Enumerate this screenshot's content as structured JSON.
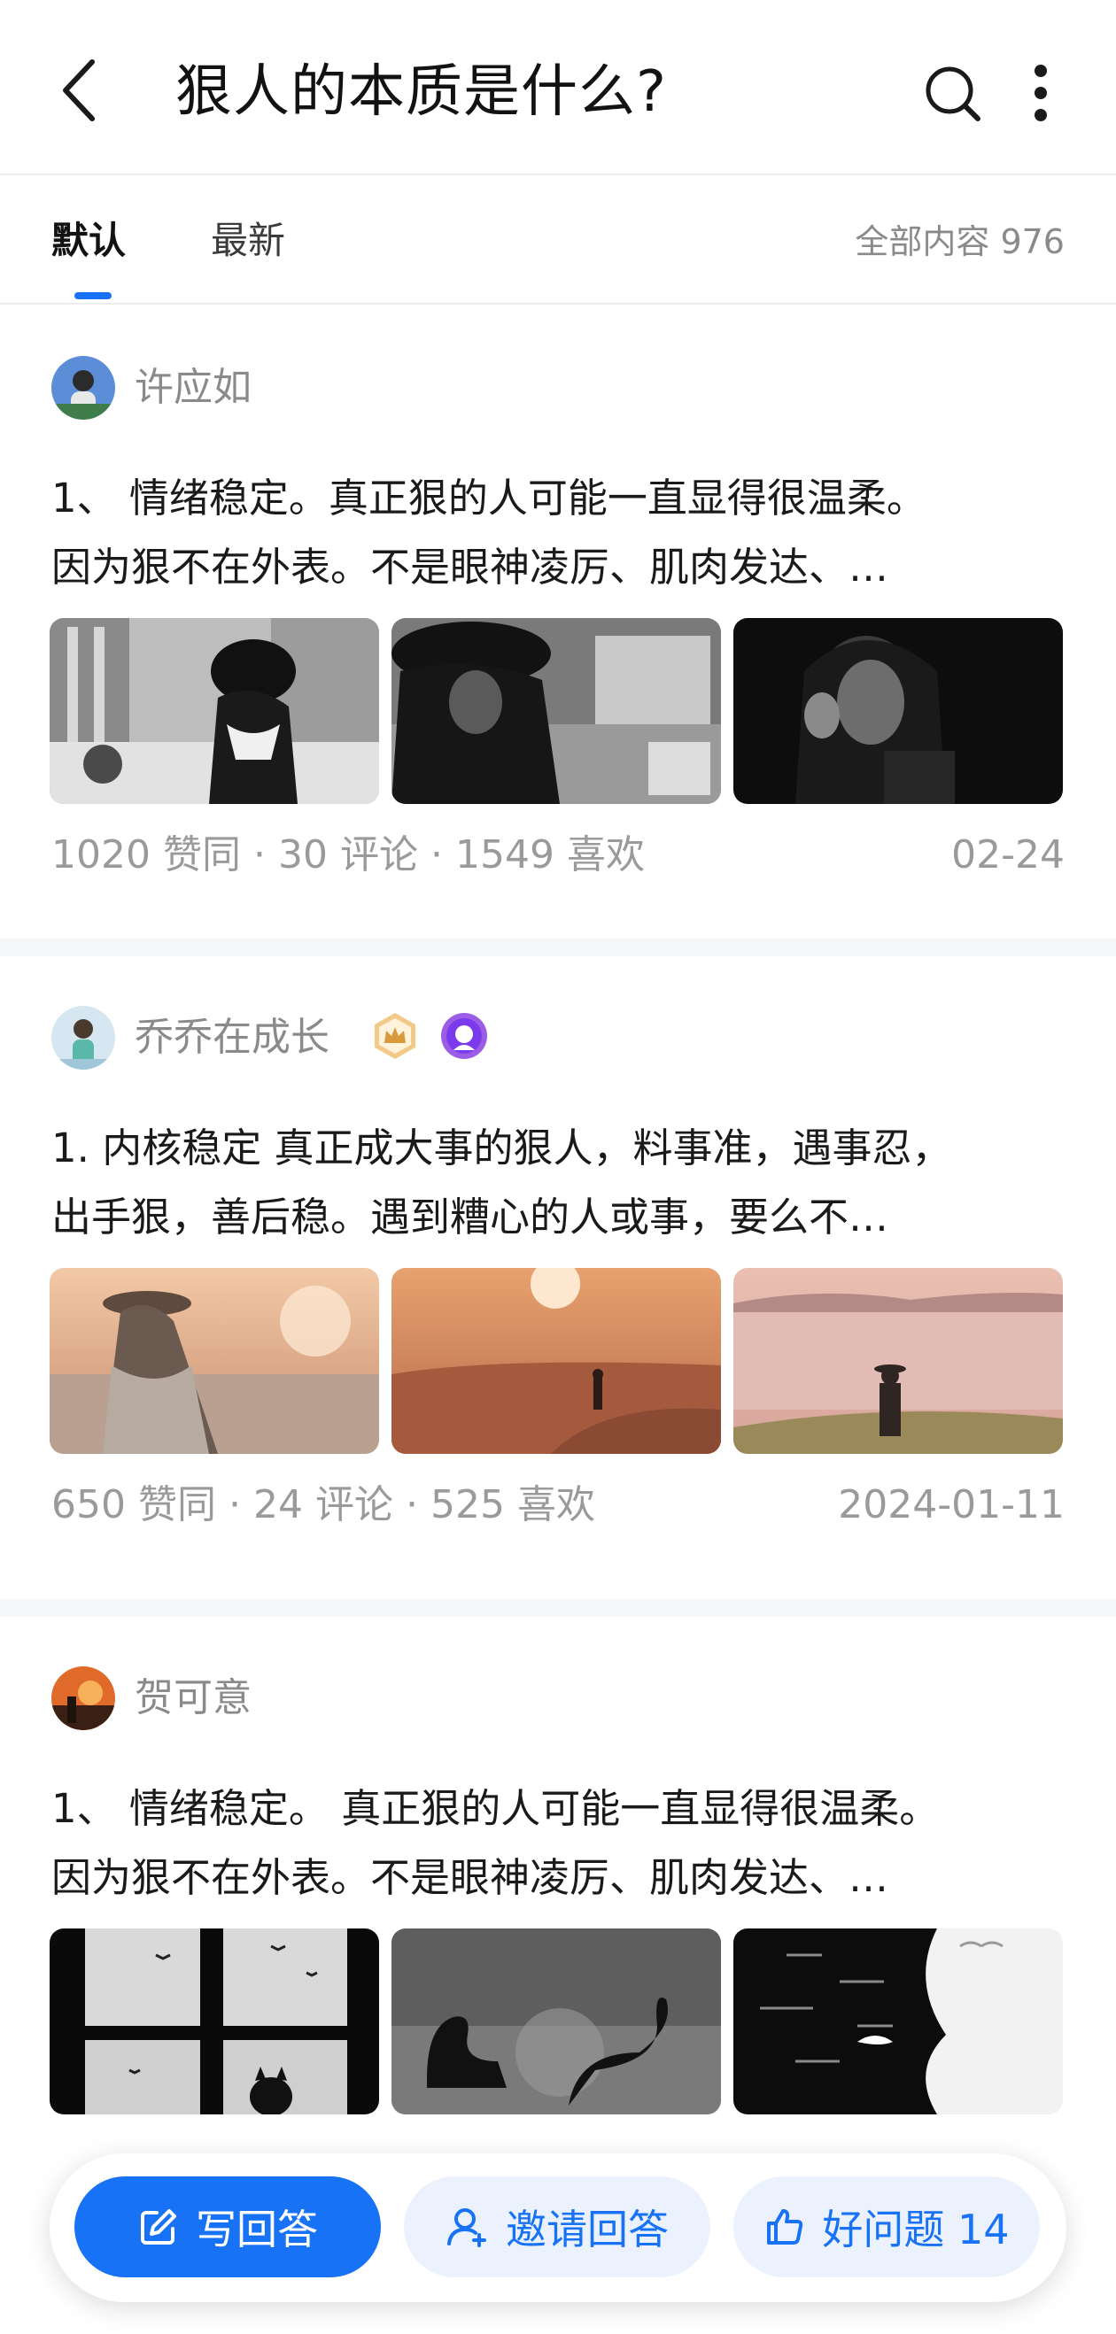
{
  "header": {
    "title": "狠人的本质是什么?",
    "back_icon": "chevron-left-icon",
    "search_icon": "search-icon",
    "more_icon": "more-vertical-icon"
  },
  "tabs": {
    "items": [
      {
        "label": "默认",
        "active": true
      },
      {
        "label": "最新",
        "active": false
      }
    ],
    "total_label": "全部内容 976"
  },
  "answers": [
    {
      "author": "许应如",
      "excerpt_line1": "1、 情绪稳定。真正狠的人可能一直显得很温柔。",
      "excerpt_line2": "因为狠不在外表。不是眼神凌厉、肌肉发达、…",
      "agree_count": "1020",
      "agree_label": "赞同",
      "comment_count": "30",
      "comment_label": "评论",
      "like_count": "1549",
      "like_label": "喜欢",
      "date": "02-24"
    },
    {
      "author": "乔乔在成长",
      "badges": [
        "crown-badge-icon",
        "purple-avatar-badge-icon"
      ],
      "excerpt_line1": "1. 内核稳定 真正成大事的狠人，料事准，遇事忍，",
      "excerpt_line2": "出手狠，善后稳。遇到糟心的人或事，要么不…",
      "agree_count": "650",
      "agree_label": "赞同",
      "comment_count": "24",
      "comment_label": "评论",
      "like_count": "525",
      "like_label": "喜欢",
      "date": "2024-01-11"
    },
    {
      "author": "贺可意",
      "excerpt_line1": "1、 情绪稳定。 真正狠的人可能一直显得很温柔。",
      "excerpt_line2": "因为狠不在外表。不是眼神凌厉、肌肉发达、…"
    }
  ],
  "bottom_bar": {
    "write_label": "写回答",
    "invite_label": "邀请回答",
    "good_question_label": "好问题 14"
  },
  "colors": {
    "accent": "#1772f6",
    "accent_light": "#ebf2fd",
    "muted_text": "#8a8a8a",
    "divider": "#f5f6f7"
  }
}
